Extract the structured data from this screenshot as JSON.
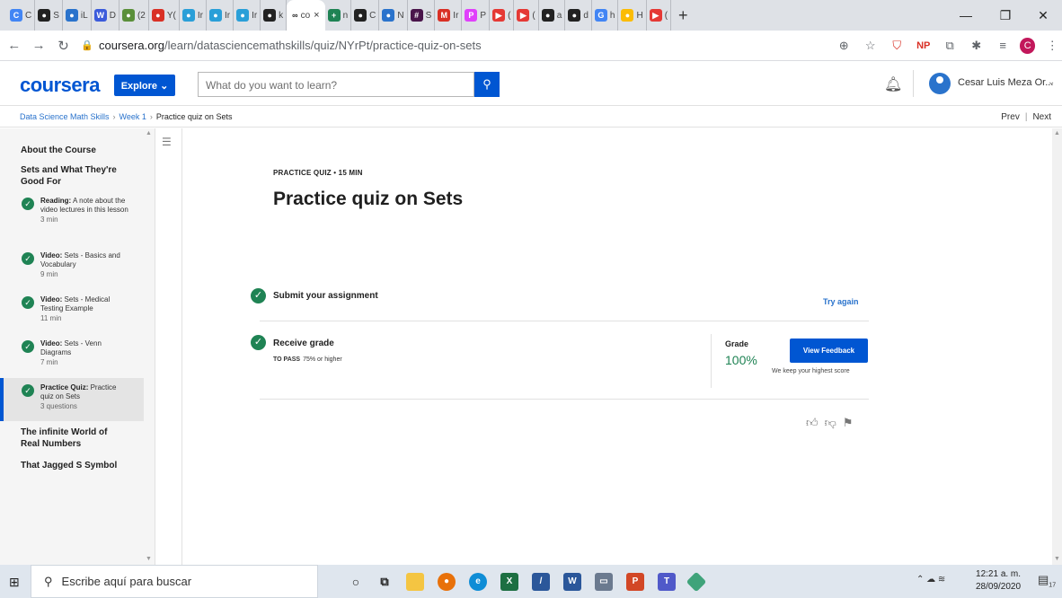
{
  "browser": {
    "tabs": [
      {
        "label": "C",
        "color": "#4285f4",
        "glyph": "C"
      },
      {
        "label": "S",
        "color": "#222222",
        "glyph": "●"
      },
      {
        "label": "iL",
        "color": "#2a73cc",
        "glyph": "●"
      },
      {
        "label": "D",
        "color": "#3b5bdb",
        "glyph": "W"
      },
      {
        "label": "(2",
        "color": "#5a8f3a",
        "glyph": "●"
      },
      {
        "label": "Y(",
        "color": "#d93025",
        "glyph": "●"
      },
      {
        "label": "Ir",
        "color": "#2a9fd8",
        "glyph": "●"
      },
      {
        "label": "Ir",
        "color": "#2a9fd8",
        "glyph": "●"
      },
      {
        "label": "Ir",
        "color": "#2a9fd8",
        "glyph": "●"
      },
      {
        "label": "k",
        "color": "#222222",
        "glyph": "●"
      }
    ],
    "active_tab": {
      "label": "co",
      "close": "×"
    },
    "tabs_right": [
      {
        "label": "n",
        "color": "#1f8354",
        "glyph": "+"
      },
      {
        "label": "C",
        "color": "#222222",
        "glyph": "●"
      },
      {
        "label": "N",
        "color": "#2a73cc",
        "glyph": "●"
      },
      {
        "label": "S",
        "color": "#4a154b",
        "glyph": "#"
      },
      {
        "label": "Ir",
        "color": "#d93025",
        "glyph": "M"
      },
      {
        "label": "P",
        "color": "#e040fb",
        "glyph": "P"
      },
      {
        "label": "(",
        "color": "#e53935",
        "glyph": "▶"
      },
      {
        "label": "(",
        "color": "#e53935",
        "glyph": "▶"
      },
      {
        "label": "a",
        "color": "#222222",
        "glyph": "●"
      },
      {
        "label": "d",
        "color": "#222222",
        "glyph": "●"
      },
      {
        "label": "h",
        "color": "#4285f4",
        "glyph": "G"
      },
      {
        "label": "H",
        "color": "#fbbc05",
        "glyph": "●"
      },
      {
        "label": "(",
        "color": "#e53935",
        "glyph": "▶"
      }
    ],
    "new_tab": "+",
    "window_controls": {
      "minimize": "—",
      "maximize": "❐",
      "close": "✕"
    },
    "url_host": "coursera.org",
    "url_path": "/learn/datasciencemathskills/quiz/NYrPt/practice-quiz-on-sets",
    "profile_initial": "C"
  },
  "header": {
    "logo": "coursera",
    "explore": "Explore ⌄",
    "search_placeholder": "What do you want to learn?",
    "user_name": "Cesar Luis Meza Or..."
  },
  "breadcrumb": {
    "course": "Data Science Math Skills",
    "week": "Week 1",
    "current": "Practice quiz on Sets",
    "prev": "Prev",
    "next": "Next"
  },
  "sidebar": {
    "about": "About the Course",
    "section1": "Sets and What They're Good For",
    "items": [
      {
        "kind": "Reading:",
        "title": "A note about the video lectures in this lesson",
        "duration": "3 min"
      },
      {
        "kind": "Video:",
        "title": "Sets - Basics and Vocabulary",
        "duration": "9 min"
      },
      {
        "kind": "Video:",
        "title": "Sets - Medical Testing Example",
        "duration": "11 min"
      },
      {
        "kind": "Video:",
        "title": "Sets - Venn Diagrams",
        "duration": "7 min"
      },
      {
        "kind": "Practice Quiz:",
        "title": "Practice quiz on Sets",
        "duration": "3 questions"
      }
    ],
    "section2": "The infinite World of Real Numbers",
    "section3": "That Jagged S Symbol"
  },
  "main": {
    "quiz_type": "PRACTICE QUIZ • 15 MIN",
    "title": "Practice quiz on Sets",
    "submit": {
      "label": "Submit your assignment",
      "action": "Try again"
    },
    "grade": {
      "label": "Receive grade",
      "to_pass_label": "TO PASS",
      "to_pass_value": "75% or higher",
      "grade_label": "Grade",
      "grade_value": "100%",
      "view_feedback": "View Feedback",
      "note": "We keep your highest score"
    }
  },
  "taskbar": {
    "search_placeholder": "Escribe aquí para buscar",
    "time": "12:21 a. m.",
    "date": "28/09/2020",
    "notification_count": "17"
  }
}
